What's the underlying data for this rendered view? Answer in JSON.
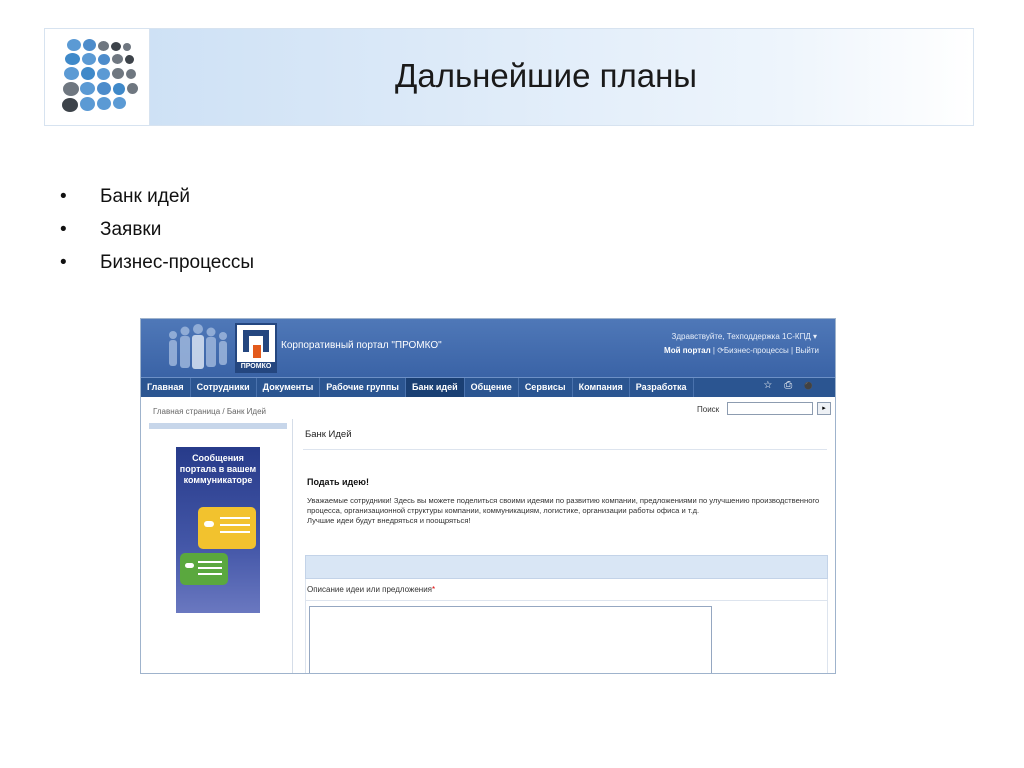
{
  "slide": {
    "title": "Дальнейшие планы",
    "bullets": [
      "Банк идей",
      "Заявки",
      "Бизнес-процессы"
    ],
    "bullet_char": "•"
  },
  "portal": {
    "logo_text": "ПРОМКО",
    "title": "Корпоративный портал \"ПРОМКО\"",
    "greeting": "Здравствуйте, Техподдержка 1С-КПД ▾",
    "links": {
      "my_portal": "Мой портал",
      "separator": "|",
      "bp_icon": "⟳",
      "business_processes": "Бизнес-процессы",
      "logout": "Выйти"
    },
    "nav": [
      {
        "label": "Главная",
        "active": false
      },
      {
        "label": "Сотрудники",
        "active": false
      },
      {
        "label": "Документы",
        "active": false
      },
      {
        "label": "Рабочие группы",
        "active": false
      },
      {
        "label": "Банк идей",
        "active": true
      },
      {
        "label": "Общение",
        "active": false
      },
      {
        "label": "Сервисы",
        "active": false
      },
      {
        "label": "Компания",
        "active": false
      },
      {
        "label": "Разработка",
        "active": false
      }
    ],
    "nav_tools": [
      "☆",
      "⎙",
      "⚫"
    ],
    "breadcrumb": "Главная страница / Банк Идей",
    "search_label": "Поиск",
    "search_value": "",
    "search_button": "▸",
    "banner_text": "Сообщения портала в вашем коммуникаторе",
    "page_title": "Банк Идей",
    "form_title": "Подать идею!",
    "description": "Уважаемые сотрудники! Здесь вы можете поделиться своими идеями по развитию компании, предложениями по улучшению производственного процесса, организационной структуры компании, коммуникациям, логистике, организации работы офиса и т.д.",
    "description_2": "Лучшие идеи будут внедряться и поощряться!",
    "field_label": "Описание идеи или предложения",
    "required_mark": "*",
    "textarea_value": ""
  },
  "colors": {
    "header_blue": "#3a63a6",
    "nav_blue": "#2b5591",
    "accent_orange": "#e35a1b"
  }
}
